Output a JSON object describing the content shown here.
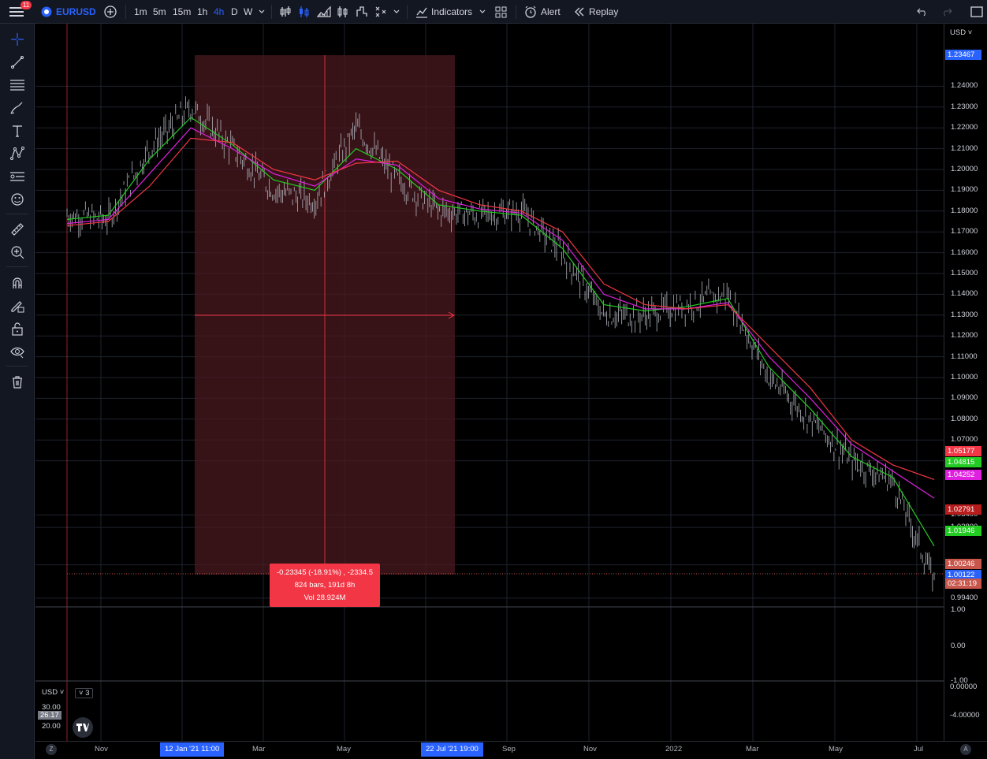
{
  "toolbar": {
    "notification_count": "11",
    "symbol": "EURUSD",
    "intervals": [
      "1m",
      "5m",
      "15m",
      "1h",
      "4h",
      "D",
      "W"
    ],
    "active_interval": "4h",
    "indicators_label": "Indicators",
    "alert_label": "Alert",
    "replay_label": "Replay",
    "icons": [
      "menu-icon",
      "symbol-flag-icon",
      "add-compare-icon",
      "interval-dropdown-icon",
      "bars-style-icon",
      "candles-style-icon",
      "area-style-icon",
      "heikin-style-icon",
      "renko-style-icon",
      "pnf-style-icon",
      "chart-style-dropdown-icon",
      "indicators-icon",
      "templates-dropdown-icon",
      "layout-grid-icon",
      "alert-icon",
      "replay-icon",
      "undo-icon",
      "redo-icon",
      "fullscreen-icon"
    ]
  },
  "left_tools": [
    "crosshair-icon",
    "trend-line-icon",
    "fib-icon",
    "brush-icon",
    "text-icon",
    "pattern-icon",
    "forecast-icon",
    "emoji-icon",
    "ruler-icon",
    "zoom-icon",
    "magnet-icon",
    "lock-drawing-icon",
    "lock-icon",
    "eye-icon",
    "trash-icon"
  ],
  "price_scale": {
    "currency": "USD",
    "labels": [
      "1.24000",
      "1.23000",
      "1.22000",
      "1.21000",
      "1.20000",
      "1.19000",
      "1.18000",
      "1.17000",
      "1.16000",
      "1.15000",
      "1.14000",
      "1.13000",
      "1.12000",
      "1.11000",
      "1.10000",
      "1.09000",
      "1.08000",
      "1.07000",
      "1.06000",
      "1.03400",
      "1.02800",
      "1.01000",
      "0.99400"
    ],
    "tags": [
      {
        "value": "1.23467",
        "color": "#2962ff"
      },
      {
        "value": "1.05177",
        "color": "#f23645"
      },
      {
        "value": "1.04815",
        "color": "#22cc22"
      },
      {
        "value": "1.04252",
        "color": "#e020e0"
      },
      {
        "value": "1.02791",
        "color": "#b71c1c"
      },
      {
        "value": "1.01946",
        "color": "#22cc22"
      },
      {
        "value": "1.00246",
        "color": "#c8564b"
      },
      {
        "value": "1.00122",
        "color": "#2962ff"
      },
      {
        "value": "02:31:19",
        "color": "#c8564b"
      }
    ]
  },
  "lower_scale": {
    "labels": [
      "1.00",
      "0.00",
      "-1.00",
      "0.00000",
      "-4.00000"
    ]
  },
  "lower_left": {
    "currency": "USD",
    "labels": [
      "30.00",
      "20.00"
    ],
    "tag": "26.17",
    "collapse_label": "3"
  },
  "time_axis": {
    "labels": [
      "Nov",
      "Mar",
      "May",
      "Sep",
      "Nov",
      "2022",
      "Mar",
      "May",
      "Jul"
    ],
    "range_start": "12 Jan '21   11:00",
    "range_end": "22 Jul '21   19:00"
  },
  "measure": {
    "line1": "-0.23345 (-18.91%) ,  -2334.5",
    "line2": "824 bars, 191d 8h",
    "line3": "Vol 28.924M"
  },
  "corner_labels": {
    "left": "Z",
    "right": "A"
  },
  "chart_data": {
    "type": "line",
    "title": "",
    "xlabel": "",
    "ylabel": "",
    "ylim": [
      0.994,
      1.24
    ],
    "x": [
      "2020-10",
      "2020-11",
      "2020-12",
      "2021-01",
      "2021-02",
      "2021-03",
      "2021-04",
      "2021-05",
      "2021-06",
      "2021-07",
      "2021-08",
      "2021-09",
      "2021-10",
      "2021-11",
      "2021-12",
      "2022-01",
      "2022-02",
      "2022-03",
      "2022-04",
      "2022-05",
      "2022-06",
      "2022-07"
    ],
    "series": [
      {
        "name": "",
        "color": "#b2b5be",
        "values": [
          1.178,
          1.176,
          1.21,
          1.23,
          1.21,
          1.19,
          1.185,
          1.22,
          1.195,
          1.18,
          1.178,
          1.18,
          1.16,
          1.13,
          1.13,
          1.135,
          1.14,
          1.1,
          1.08,
          1.06,
          1.05,
          1.002
        ]
      },
      {
        "name": "",
        "color": "#22cc22",
        "values": [
          1.176,
          1.178,
          1.205,
          1.225,
          1.212,
          1.195,
          1.19,
          1.21,
          1.2,
          1.183,
          1.18,
          1.178,
          1.162,
          1.135,
          1.132,
          1.134,
          1.138,
          1.105,
          1.085,
          1.062,
          1.052,
          1.019
        ]
      },
      {
        "name": "",
        "color": "#e020e0",
        "values": [
          1.174,
          1.176,
          1.198,
          1.22,
          1.21,
          1.198,
          1.192,
          1.205,
          1.202,
          1.186,
          1.181,
          1.179,
          1.166,
          1.14,
          1.133,
          1.133,
          1.136,
          1.11,
          1.09,
          1.068,
          1.055,
          1.042
        ]
      },
      {
        "name": "",
        "color": "#f23645",
        "values": [
          1.173,
          1.175,
          1.192,
          1.215,
          1.213,
          1.2,
          1.195,
          1.203,
          1.204,
          1.19,
          1.183,
          1.18,
          1.17,
          1.145,
          1.135,
          1.133,
          1.135,
          1.115,
          1.095,
          1.07,
          1.058,
          1.051
        ]
      }
    ]
  }
}
